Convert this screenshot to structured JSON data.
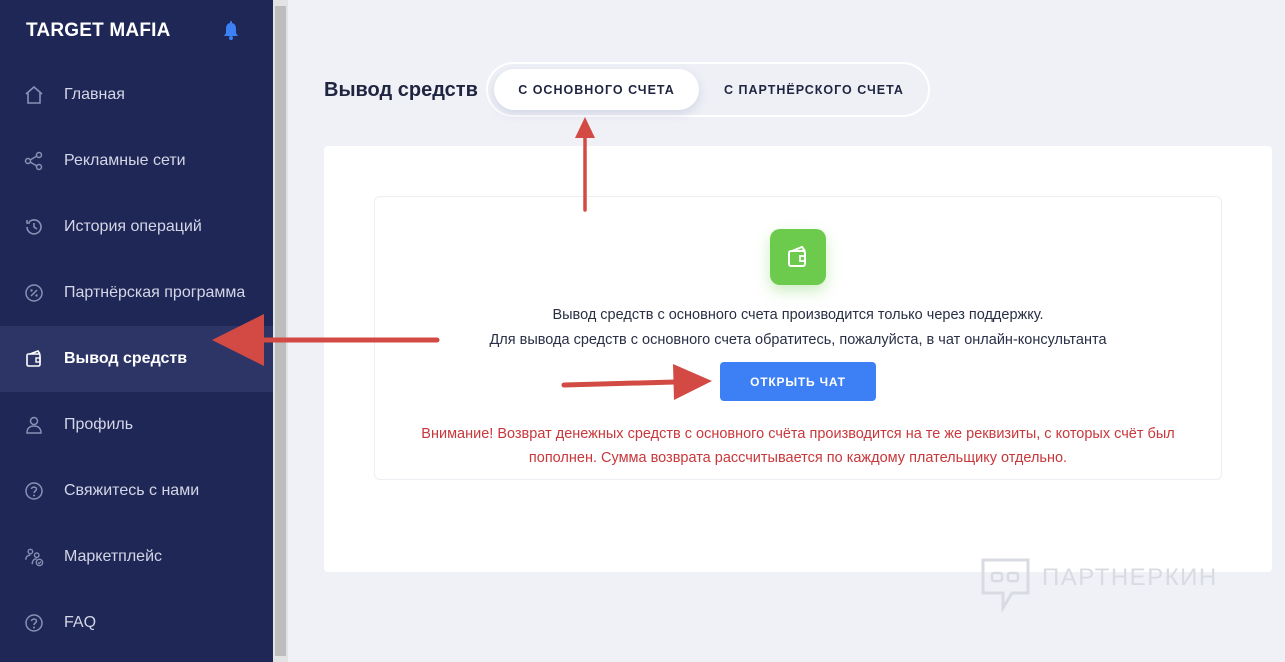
{
  "sidebar": {
    "brand": "TARGET MAFIA",
    "items": [
      {
        "label": "Главная",
        "icon": "home-icon"
      },
      {
        "label": "Рекламные сети",
        "icon": "share-icon"
      },
      {
        "label": "История операций",
        "icon": "history-icon"
      },
      {
        "label": "Партнёрская программа",
        "icon": "percent-icon"
      },
      {
        "label": "Вывод средств",
        "icon": "wallet-icon",
        "active": true
      },
      {
        "label": "Профиль",
        "icon": "user-icon"
      },
      {
        "label": "Свяжитесь с нами",
        "icon": "question-icon"
      },
      {
        "label": "Маркетплейс",
        "icon": "marketplace-icon"
      },
      {
        "label": "FAQ",
        "icon": "faq-icon"
      }
    ]
  },
  "main": {
    "title": "Вывод средств",
    "tabs": [
      {
        "label": "С ОСНОВНОГО СЧЕТА",
        "active": true
      },
      {
        "label": "С ПАРТНЁРСКОГО СЧЕТА",
        "active": false
      }
    ],
    "card": {
      "message_line1": "Вывод средств с основного счета производится только через поддержку.",
      "message_line2": "Для вывода средств с основного счета обратитесь, пожалуйста, в чат онлайн-консультанта",
      "button_label": "ОТКРЫТЬ ЧАТ",
      "warning_line1": "Внимание! Возврат денежных средств с основного счёта производится на те же реквизиты, с которых счёт был",
      "warning_line2": "пополнен. Сумма возврата рассчитывается по каждому плательщику отдельно."
    }
  },
  "watermark": {
    "text": "ПАРТНЕРКИН"
  },
  "colors": {
    "sidebar_bg": "#1f2756",
    "sidebar_active_bg": "#2c3566",
    "accent_blue": "#3d7ff5",
    "icon_green": "#6ccb4d",
    "warning_red": "#c9373b",
    "annotation_arrow": "#d24a43"
  }
}
